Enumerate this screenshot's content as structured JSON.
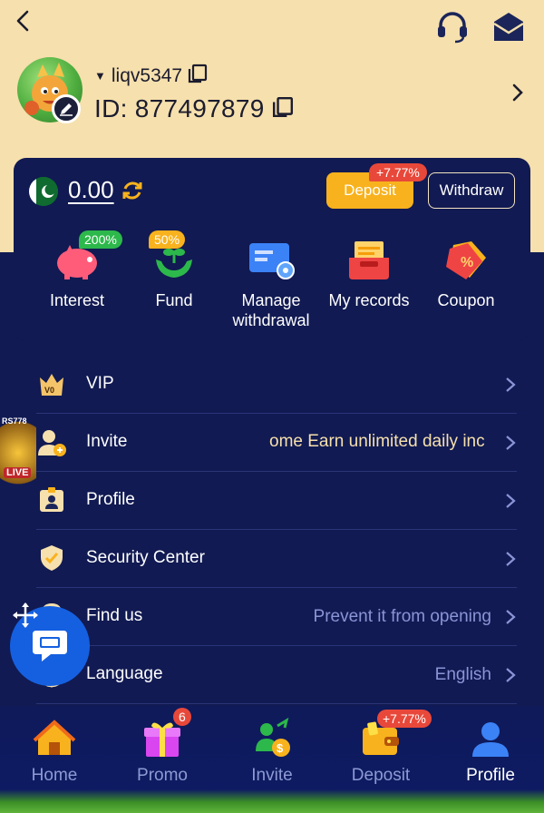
{
  "header": {
    "back_icon": "back-arrow-icon",
    "support_icon": "headset-icon",
    "mail_icon": "mail-icon"
  },
  "user": {
    "name": "liqv5347",
    "id_text": "ID: 877497879"
  },
  "wallet": {
    "balance": "0.00",
    "deposit_label": "Deposit",
    "deposit_bonus": "+7.77%",
    "withdraw_label": "Withdraw"
  },
  "quick_actions": [
    {
      "label": "Interest",
      "badge": "200%",
      "icon": "piggy-bank-icon"
    },
    {
      "label": "Fund",
      "badge": "50%",
      "icon": "hands-plant-icon"
    },
    {
      "label": "Manage withdrawal",
      "icon": "card-gear-icon"
    },
    {
      "label": "My records",
      "icon": "records-tray-icon"
    },
    {
      "label": "Coupon",
      "icon": "coupon-tag-icon"
    }
  ],
  "menu": [
    {
      "label": "VIP",
      "icon": "vip-crown-icon",
      "value": ""
    },
    {
      "label": "Invite",
      "icon": "invite-user-icon",
      "value": "ome  Earn unlimited daily inc"
    },
    {
      "label": "Profile",
      "icon": "id-card-icon",
      "value": ""
    },
    {
      "label": "Security Center",
      "icon": "shield-check-icon",
      "value": ""
    },
    {
      "label": "Find us",
      "icon": "location-icon",
      "value": "Prevent it from opening"
    },
    {
      "label": "Language",
      "icon": "globe-icon",
      "value": "English"
    }
  ],
  "floating": {
    "live_brand": "RS778",
    "live_label": "LIVE"
  },
  "bottom_nav": [
    {
      "label": "Home",
      "icon": "home-icon",
      "active": false
    },
    {
      "label": "Promo",
      "icon": "gift-icon",
      "badge": "6",
      "active": false
    },
    {
      "label": "Invite",
      "icon": "invite-money-icon",
      "active": false
    },
    {
      "label": "Deposit",
      "icon": "wallet-icon",
      "badge": "+7.77%",
      "active": false
    },
    {
      "label": "Profile",
      "icon": "profile-icon",
      "active": true
    }
  ],
  "colors": {
    "header_bg": "#f6e0ad",
    "page_bg": "#111a52",
    "accent": "#f8b21d",
    "badge_red": "#e8483a"
  }
}
